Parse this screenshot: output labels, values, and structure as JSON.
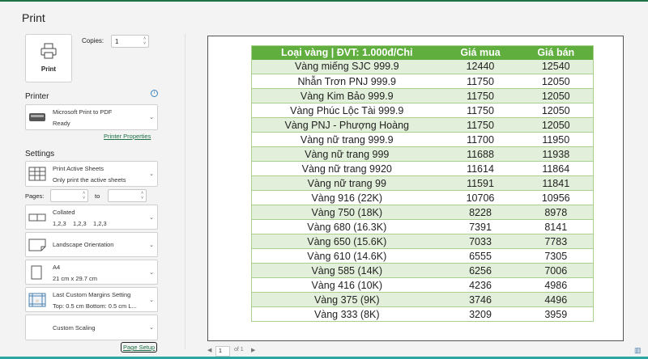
{
  "title": "Print",
  "print_button": "Print",
  "copies": {
    "label": "Copies:",
    "value": "1"
  },
  "printer": {
    "heading": "Printer",
    "name": "Microsoft Print to PDF",
    "status": "Ready",
    "properties_link": "Printer Properties"
  },
  "settings": {
    "heading": "Settings",
    "what": {
      "title": "Print Active Sheets",
      "sub": "Only print the active sheets"
    },
    "pages_label": "Pages:",
    "to_label": "to",
    "pages_from": "",
    "pages_to": "",
    "collate": {
      "title": "Collated",
      "sub": "1,2,3    1,2,3    1,2,3"
    },
    "orientation": "Landscape Orientation",
    "paper": {
      "title": "A4",
      "sub": "21 cm x 29.7 cm"
    },
    "margins": {
      "title": "Last Custom Margins Setting",
      "sub": "Top: 0.5 cm Bottom: 0.5 cm L..."
    },
    "scaling": "Custom Scaling",
    "page_setup_link": "Page Setup"
  },
  "preview": {
    "headers": [
      "Loại vàng | ĐVT: 1.000đ/Chỉ",
      "Giá mua",
      "Giá bán"
    ],
    "rows": [
      [
        "Vàng miếng SJC 999.9",
        "12440",
        "12540"
      ],
      [
        "Nhẫn Trơn PNJ 999.9",
        "11750",
        "12050"
      ],
      [
        "Vàng Kim Bảo 999.9",
        "11750",
        "12050"
      ],
      [
        "Vàng Phúc Lộc Tài 999.9",
        "11750",
        "12050"
      ],
      [
        "Vàng PNJ - Phượng Hoàng",
        "11750",
        "12050"
      ],
      [
        "Vàng nữ trang 999.9",
        "11700",
        "11950"
      ],
      [
        "Vàng nữ trang 999",
        "11688",
        "11938"
      ],
      [
        "Vàng nữ trang 9920",
        "11614",
        "11864"
      ],
      [
        "Vàng nữ trang 99",
        "11591",
        "11841"
      ],
      [
        "Vàng 916 (22K)",
        "10706",
        "10956"
      ],
      [
        "Vàng 750 (18K)",
        "8228",
        "8978"
      ],
      [
        "Vàng 680 (16.3K)",
        "7391",
        "8141"
      ],
      [
        "Vàng 650 (15.6K)",
        "7033",
        "7783"
      ],
      [
        "Vàng 610 (14.6K)",
        "6555",
        "7305"
      ],
      [
        "Vàng 585 (14K)",
        "6256",
        "7006"
      ],
      [
        "Vàng 416 (10K)",
        "4236",
        "4986"
      ],
      [
        "Vàng 375 (9K)",
        "3746",
        "4496"
      ],
      [
        "Vàng 333 (8K)",
        "3209",
        "3959"
      ]
    ]
  },
  "pager": {
    "current": "1",
    "of": "of 1"
  }
}
